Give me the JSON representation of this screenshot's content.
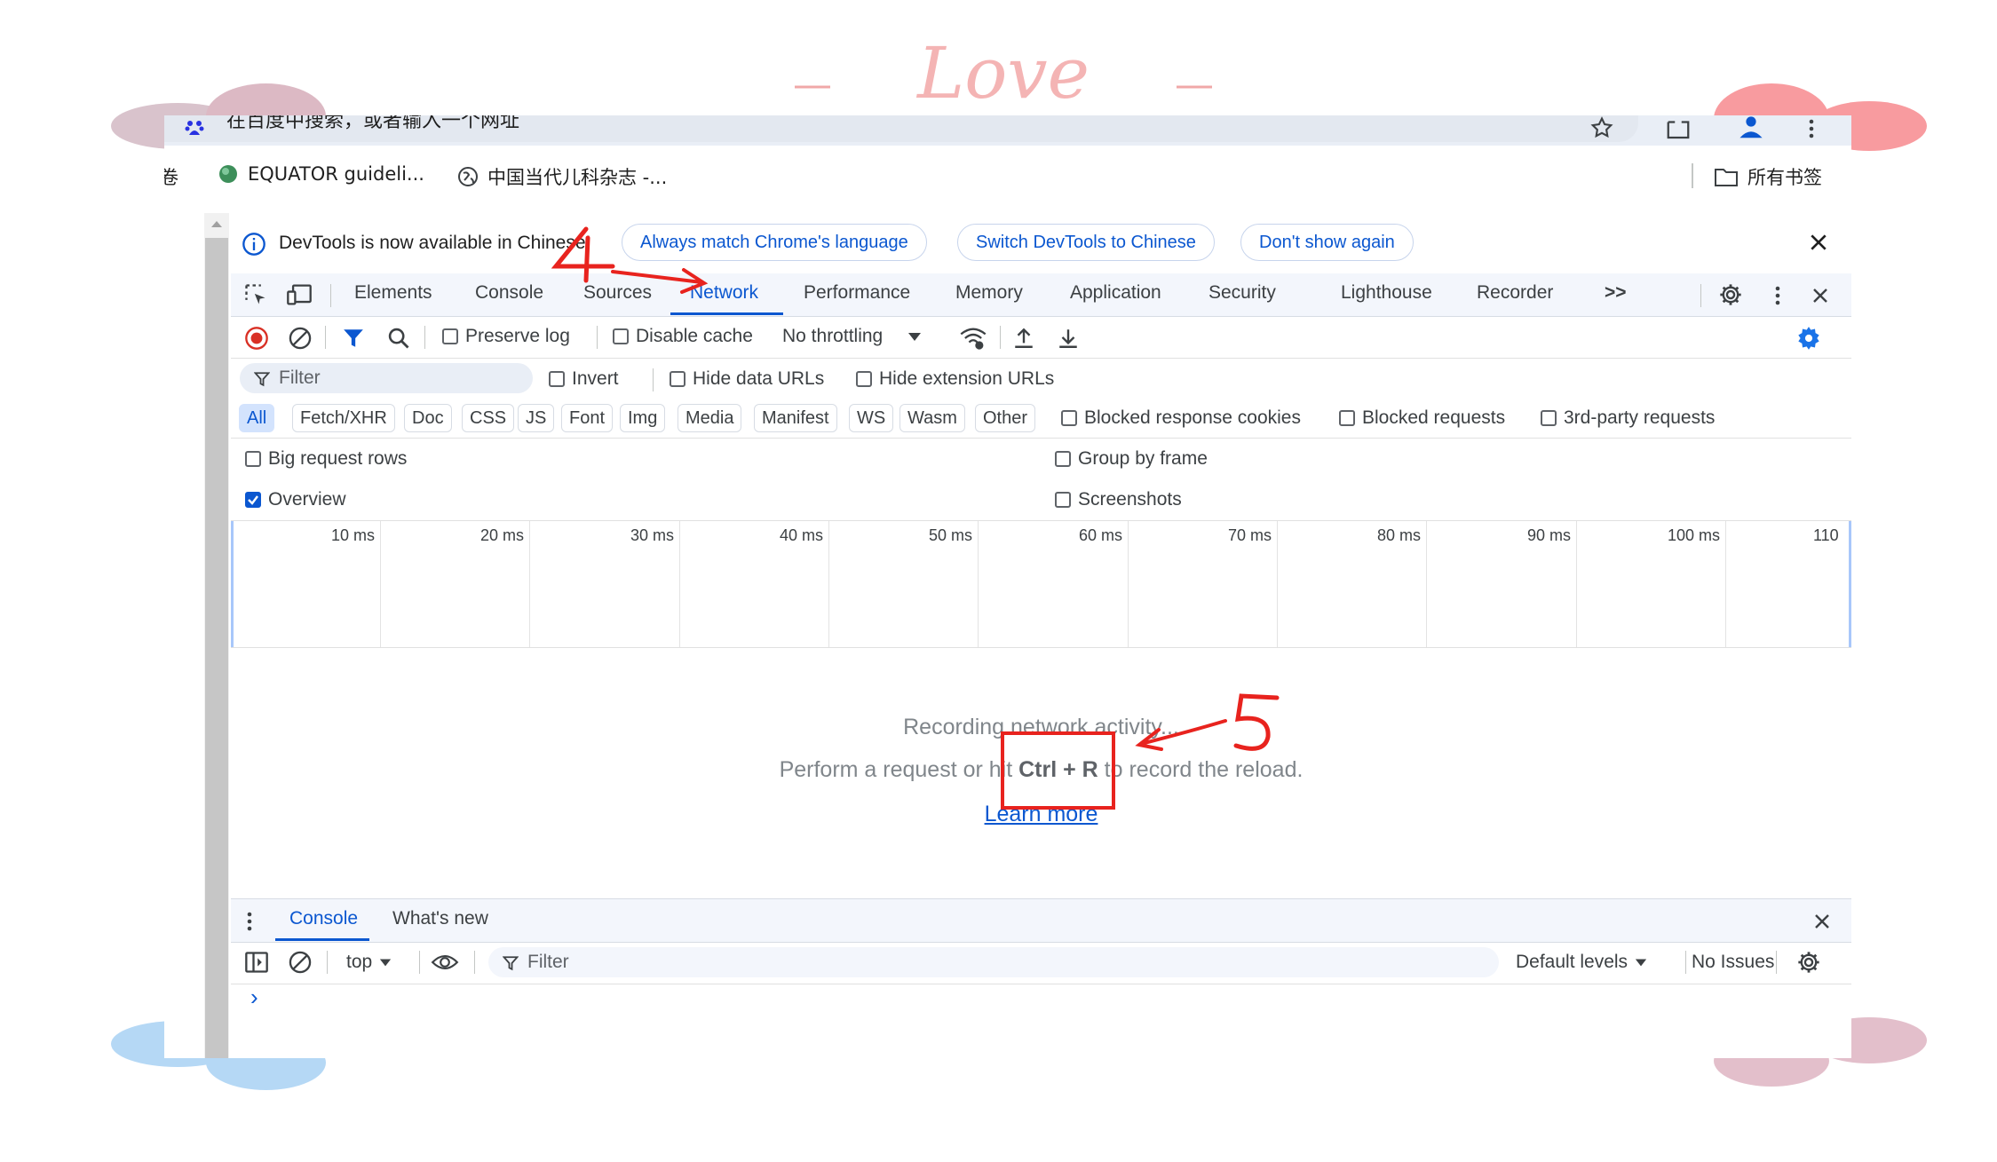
{
  "decoration": {
    "love_text": "Love"
  },
  "browser": {
    "omnibox_placeholder": "在百度中搜索，或者输入一个网址",
    "bookmarks": [
      {
        "label": "问卷",
        "icon": "bookmark-icon"
      },
      {
        "label": "EQUATOR guideli...",
        "icon": "globe-icon"
      },
      {
        "label": "中国当代儿科杂志 -...",
        "icon": "globe-icon"
      }
    ],
    "all_bookmarks_label": "所有书签"
  },
  "devtools": {
    "info_bar": {
      "message": "DevTools is now available in Chinese!",
      "buttons": [
        "Always match Chrome's language",
        "Switch DevTools to Chinese",
        "Don't show again"
      ]
    },
    "tabs": [
      "Elements",
      "Console",
      "Sources",
      "Network",
      "Performance",
      "Memory",
      "Application",
      "Security",
      "Lighthouse",
      "Recorder"
    ],
    "active_tab": "Network",
    "more_tabs": ">>",
    "toolbar": {
      "preserve_log": "Preserve log",
      "disable_cache": "Disable cache",
      "throttling": "No throttling"
    },
    "filter": {
      "placeholder": "Filter",
      "invert": "Invert",
      "hide_data_urls": "Hide data URLs",
      "hide_extension_urls": "Hide extension URLs"
    },
    "types": [
      "All",
      "Fetch/XHR",
      "Doc",
      "CSS",
      "JS",
      "Font",
      "Img",
      "Media",
      "Manifest",
      "WS",
      "Wasm",
      "Other"
    ],
    "type_checkboxes": [
      "Blocked response cookies",
      "Blocked requests",
      "3rd-party requests"
    ],
    "options": {
      "big_request_rows": "Big request rows",
      "group_by_frame": "Group by frame",
      "overview": "Overview",
      "screenshots": "Screenshots"
    },
    "timeline_ticks": [
      "10 ms",
      "20 ms",
      "30 ms",
      "40 ms",
      "50 ms",
      "60 ms",
      "70 ms",
      "80 ms",
      "90 ms",
      "100 ms",
      "110"
    ],
    "empty_state": {
      "line1": "Recording network activity...",
      "line2_pre": "Perform a request or hit ",
      "shortcut": "Ctrl + R",
      "line2_post": " to record the reload.",
      "learn_more": "Learn more"
    },
    "drawer": {
      "tabs": [
        "Console",
        "What's new"
      ],
      "context": "top",
      "filter_placeholder": "Filter",
      "levels": "Default levels",
      "issues": "No Issues",
      "prompt": "›"
    }
  },
  "annotations": {
    "step4": "4",
    "step5": "5"
  },
  "colors": {
    "accent": "#0b57d0",
    "annotation_red": "#e8231e",
    "record_red": "#d93025"
  }
}
